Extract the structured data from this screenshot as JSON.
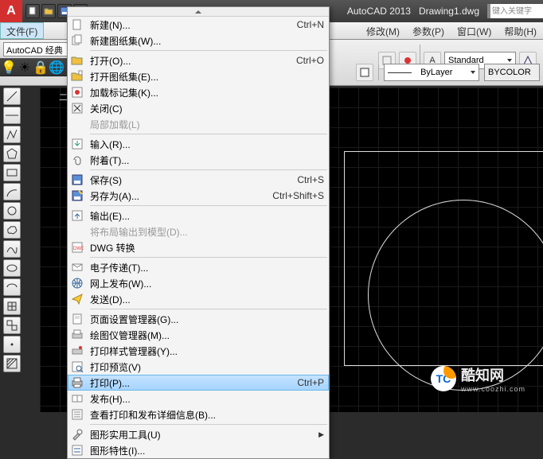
{
  "title": {
    "app": "AutoCAD 2013",
    "doc": "Drawing1.dwg",
    "search_placeholder": "键入关键字"
  },
  "menubar": {
    "file": "文件(F)",
    "modify": "修改(M)",
    "param": "参数(P)",
    "window": "窗口(W)",
    "help": "帮助(H)"
  },
  "ribbon": {
    "standard": "Standard",
    "bylayer": "ByLayer",
    "bycolor": "BYCOLOR"
  },
  "workspace": {
    "label": "AutoCAD 经典"
  },
  "canvas": {
    "axis": "二..."
  },
  "dropdown": {
    "items": [
      {
        "icon": "new-icon",
        "label": "新建(N)...",
        "shortcut": "Ctrl+N"
      },
      {
        "icon": "sheetset-icon",
        "label": "新建图纸集(W)...",
        "shortcut": ""
      },
      {
        "sep": true
      },
      {
        "icon": "open-icon",
        "label": "打开(O)...",
        "shortcut": "Ctrl+O"
      },
      {
        "icon": "sheetset-open-icon",
        "label": "打开图纸集(E)...",
        "shortcut": ""
      },
      {
        "icon": "load-icon",
        "label": "加载标记集(K)...",
        "shortcut": ""
      },
      {
        "icon": "close-icon",
        "label": "关闭(C)",
        "shortcut": ""
      },
      {
        "icon": "partial-icon",
        "label": "局部加载(L)",
        "shortcut": "",
        "disabled": true
      },
      {
        "sep": true
      },
      {
        "icon": "import-icon",
        "label": "输入(R)...",
        "shortcut": ""
      },
      {
        "icon": "attach-icon",
        "label": "附着(T)...",
        "shortcut": ""
      },
      {
        "sep": true
      },
      {
        "icon": "save-icon",
        "label": "保存(S)",
        "shortcut": "Ctrl+S"
      },
      {
        "icon": "saveas-icon",
        "label": "另存为(A)...",
        "shortcut": "Ctrl+Shift+S"
      },
      {
        "sep": true
      },
      {
        "icon": "export-icon",
        "label": "输出(E)...",
        "shortcut": ""
      },
      {
        "icon": "export-layout-icon",
        "label": "将布局输出到模型(D)...",
        "shortcut": "",
        "disabled": true
      },
      {
        "icon": "dwg-icon",
        "label": "DWG 转换",
        "shortcut": ""
      },
      {
        "sep": true
      },
      {
        "icon": "etransmit-icon",
        "label": "电子传递(T)...",
        "shortcut": ""
      },
      {
        "icon": "web-icon",
        "label": "网上发布(W)...",
        "shortcut": ""
      },
      {
        "icon": "send-icon",
        "label": "发送(D)...",
        "shortcut": ""
      },
      {
        "sep": true
      },
      {
        "icon": "page-setup-icon",
        "label": "页面设置管理器(G)...",
        "shortcut": ""
      },
      {
        "icon": "plotter-icon",
        "label": "绘图仪管理器(M)...",
        "shortcut": ""
      },
      {
        "icon": "plot-style-icon",
        "label": "打印样式管理器(Y)...",
        "shortcut": ""
      },
      {
        "icon": "preview-icon",
        "label": "打印预览(V)",
        "shortcut": ""
      },
      {
        "icon": "print-icon",
        "label": "打印(P)...",
        "shortcut": "Ctrl+P",
        "highlighted": true
      },
      {
        "icon": "publish-icon",
        "label": "发布(H)...",
        "shortcut": ""
      },
      {
        "icon": "view-details-icon",
        "label": "查看打印和发布详细信息(B)...",
        "shortcut": ""
      },
      {
        "sep": true
      },
      {
        "icon": "utilities-icon",
        "label": "图形实用工具(U)",
        "shortcut": "",
        "sub": true
      },
      {
        "icon": "props-icon",
        "label": "图形特性(I)...",
        "shortcut": ""
      }
    ]
  },
  "watermark": {
    "brand": "酷知网",
    "url": "www.coozhi.com",
    "logo": "TC"
  }
}
